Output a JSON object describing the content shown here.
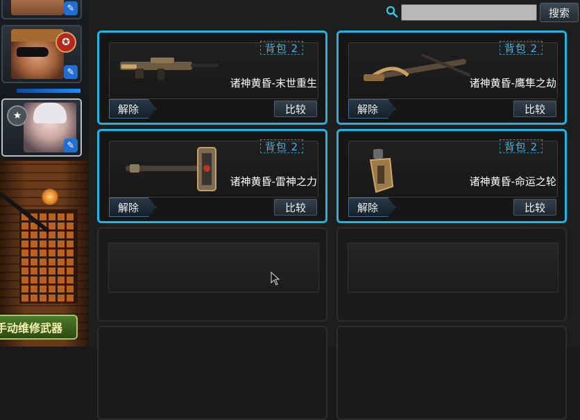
{
  "search": {
    "placeholder": "",
    "value": "",
    "button_label": "搜索"
  },
  "left_panel": {
    "repair_button_label": "手动维修武器",
    "avatars": [
      {
        "name": "character-1",
        "selected": false
      },
      {
        "name": "character-2",
        "selected": false
      },
      {
        "name": "character-3",
        "selected": true
      }
    ]
  },
  "items": [
    {
      "slot": "背包 2",
      "name": "诸神黄昏-末世重生",
      "weapon_type": "rifle",
      "unequip_label": "解除",
      "compare_label": "比较"
    },
    {
      "slot": "背包 2",
      "name": "诸神黄昏-鹰隼之劫",
      "weapon_type": "crossbow",
      "unequip_label": "解除",
      "compare_label": "比较"
    },
    {
      "slot": "背包 2",
      "name": "诸神黄昏-雷神之力",
      "weapon_type": "hammer",
      "unequip_label": "解除",
      "compare_label": "比较"
    },
    {
      "slot": "背包 2",
      "name": "诸神黄昏-命运之轮",
      "weapon_type": "grenade",
      "unequip_label": "解除",
      "compare_label": "比较"
    }
  ],
  "colors": {
    "card_border": "#1ab6e6",
    "bag_tag": "#3fb6e8",
    "repair_text": "#f4f1b0"
  }
}
